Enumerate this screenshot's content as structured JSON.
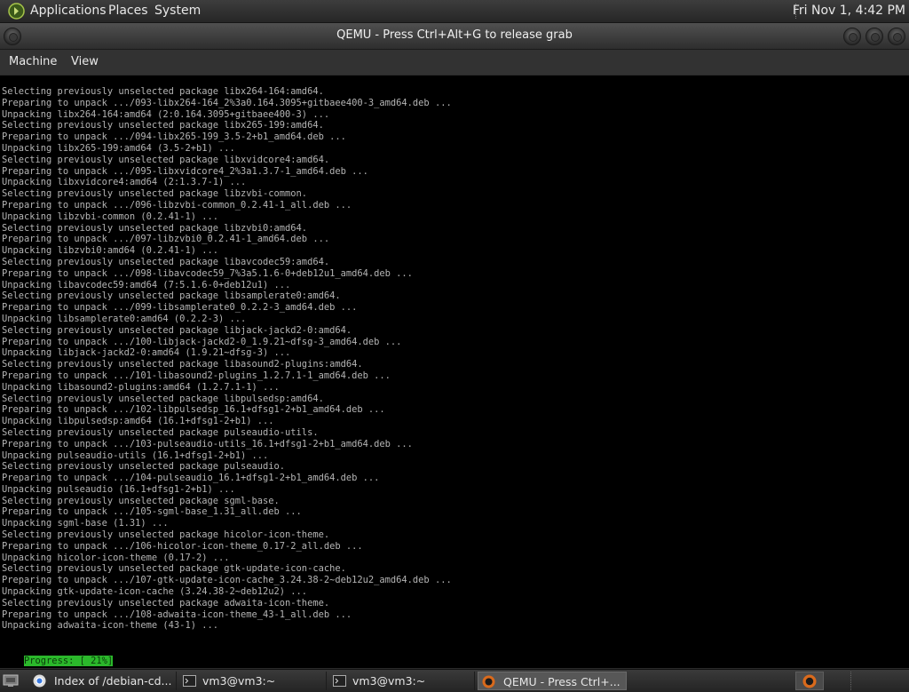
{
  "top_panel": {
    "menus": [
      "Applications",
      "Places",
      "System"
    ],
    "clock": "Fri Nov  1,  4:42 PM"
  },
  "window": {
    "title": "QEMU - Press Ctrl+Alt+G to release grab",
    "menus": [
      "Machine",
      "View"
    ]
  },
  "console": {
    "lines": [
      "Selecting previously unselected package libx264-164:amd64.",
      "Preparing to unpack .../093-libx264-164_2%3a0.164.3095+gitbaee400-3_amd64.deb ...",
      "Unpacking libx264-164:amd64 (2:0.164.3095+gitbaee400-3) ...",
      "Selecting previously unselected package libx265-199:amd64.",
      "Preparing to unpack .../094-libx265-199_3.5-2+b1_amd64.deb ...",
      "Unpacking libx265-199:amd64 (3.5-2+b1) ...",
      "Selecting previously unselected package libxvidcore4:amd64.",
      "Preparing to unpack .../095-libxvidcore4_2%3a1.3.7-1_amd64.deb ...",
      "Unpacking libxvidcore4:amd64 (2:1.3.7-1) ...",
      "Selecting previously unselected package libzvbi-common.",
      "Preparing to unpack .../096-libzvbi-common_0.2.41-1_all.deb ...",
      "Unpacking libzvbi-common (0.2.41-1) ...",
      "Selecting previously unselected package libzvbi0:amd64.",
      "Preparing to unpack .../097-libzvbi0_0.2.41-1_amd64.deb ...",
      "Unpacking libzvbi0:amd64 (0.2.41-1) ...",
      "Selecting previously unselected package libavcodec59:amd64.",
      "Preparing to unpack .../098-libavcodec59_7%3a5.1.6-0+deb12u1_amd64.deb ...",
      "Unpacking libavcodec59:amd64 (7:5.1.6-0+deb12u1) ...",
      "Selecting previously unselected package libsamplerate0:amd64.",
      "Preparing to unpack .../099-libsamplerate0_0.2.2-3_amd64.deb ...",
      "Unpacking libsamplerate0:amd64 (0.2.2-3) ...",
      "Selecting previously unselected package libjack-jackd2-0:amd64.",
      "Preparing to unpack .../100-libjack-jackd2-0_1.9.21~dfsg-3_amd64.deb ...",
      "Unpacking libjack-jackd2-0:amd64 (1.9.21~dfsg-3) ...",
      "Selecting previously unselected package libasound2-plugins:amd64.",
      "Preparing to unpack .../101-libasound2-plugins_1.2.7.1-1_amd64.deb ...",
      "Unpacking libasound2-plugins:amd64 (1.2.7.1-1) ...",
      "Selecting previously unselected package libpulsedsp:amd64.",
      "Preparing to unpack .../102-libpulsedsp_16.1+dfsg1-2+b1_amd64.deb ...",
      "Unpacking libpulsedsp:amd64 (16.1+dfsg1-2+b1) ...",
      "Selecting previously unselected package pulseaudio-utils.",
      "Preparing to unpack .../103-pulseaudio-utils_16.1+dfsg1-2+b1_amd64.deb ...",
      "Unpacking pulseaudio-utils (16.1+dfsg1-2+b1) ...",
      "Selecting previously unselected package pulseaudio.",
      "Preparing to unpack .../104-pulseaudio_16.1+dfsg1-2+b1_amd64.deb ...",
      "Unpacking pulseaudio (16.1+dfsg1-2+b1) ...",
      "Selecting previously unselected package sgml-base.",
      "Preparing to unpack .../105-sgml-base_1.31_all.deb ...",
      "Unpacking sgml-base (1.31) ...",
      "Selecting previously unselected package hicolor-icon-theme.",
      "Preparing to unpack .../106-hicolor-icon-theme_0.17-2_all.deb ...",
      "Unpacking hicolor-icon-theme (0.17-2) ...",
      "Selecting previously unselected package gtk-update-icon-cache.",
      "Preparing to unpack .../107-gtk-update-icon-cache_3.24.38-2~deb12u2_amd64.deb ...",
      "Unpacking gtk-update-icon-cache (3.24.38-2~deb12u2) ...",
      "Selecting previously unselected package adwaita-icon-theme.",
      "Preparing to unpack .../108-adwaita-icon-theme_43-1_all.deb ...",
      "Unpacking adwaita-icon-theme (43-1) ..."
    ],
    "progress": {
      "label": "Progress: [ 21%]",
      "percent": 21,
      "bar_text": "[###########################.........................................................................................................]"
    }
  },
  "taskbar": {
    "tasks": [
      {
        "label": "Index of /debian-cd...",
        "icon": "chrome-icon",
        "active": false
      },
      {
        "label": "vm3@vm3:~",
        "icon": "terminal-icon",
        "active": false
      },
      {
        "label": "vm3@vm3:~",
        "icon": "terminal-icon",
        "active": false
      },
      {
        "label": "QEMU - Press Ctrl+...",
        "icon": "qemu-icon",
        "active": true
      }
    ]
  },
  "colors": {
    "progress_green": "#2bb82b",
    "console_text": "#b4b4b4"
  }
}
